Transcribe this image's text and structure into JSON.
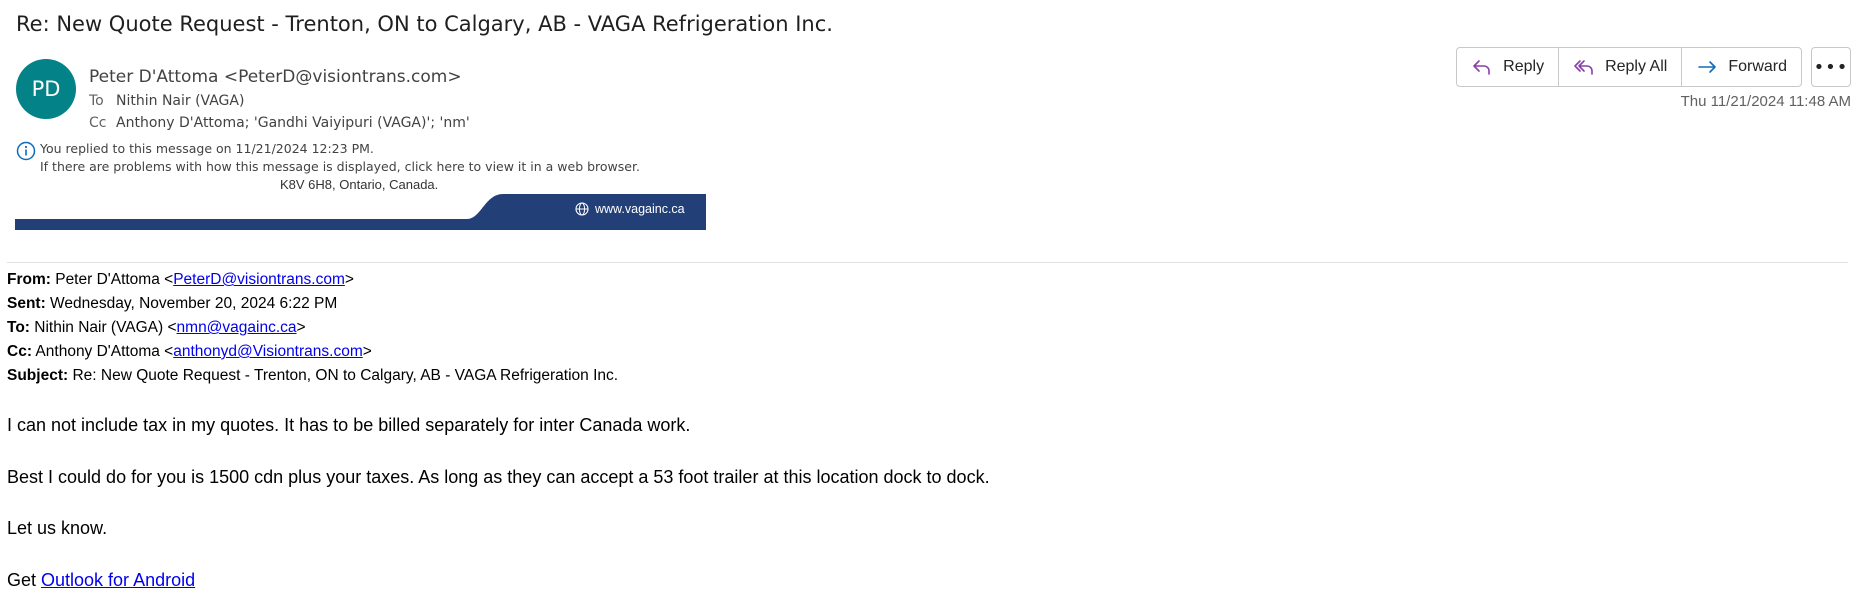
{
  "message": {
    "subject": "Re: New Quote Request - Trenton, ON to Calgary, AB - VAGA Refrigeration Inc.",
    "avatar_initials": "PD",
    "avatar_color": "#038387",
    "sender": "Peter D'Attoma <PeterD@visiontrans.com>",
    "to_label": "To",
    "to_value": "Nithin Nair (VAGA)",
    "cc_label": "Cc",
    "cc_value": "Anthony D'Attoma; 'Gandhi Vaiyipuri (VAGA)'; 'nm'",
    "date": "Thu 11/21/2024 11:48 AM",
    "info_line1": "You replied to this message on 11/21/2024 12:23 PM.",
    "info_line2": "If there are problems with how this message is displayed, click here to view it in a web browser."
  },
  "toolbar": {
    "reply": "Reply",
    "reply_all": "Reply All",
    "forward": "Forward",
    "more": "•••"
  },
  "banner": {
    "address_cut": "K8V 6H8, Ontario, Canada.",
    "website": "www.vagainc.ca",
    "color": "#233f78"
  },
  "quoted_header": {
    "from_label": "From:",
    "from_name": " Peter D'Attoma <",
    "from_email": "PeterD@visiontrans.com",
    "sent_label": "Sent:",
    "sent_value": " Wednesday, November 20, 2024 6:22 PM",
    "to_label": "To:",
    "to_name": " Nithin Nair (VAGA) <",
    "to_email": "nmn@vagainc.ca",
    "cc_label": "Cc:",
    "cc_name": " Anthony D'Attoma <",
    "cc_email": "anthonyd@Visiontrans.com",
    "subject_label": "Subject:",
    "subject_value": " Re: New Quote Request - Trenton, ON to Calgary, AB - VAGA Refrigeration Inc.",
    "close_bracket": ">"
  },
  "body": {
    "p1": "I can not include tax in my quotes. It has to be billed separately for inter Canada work.",
    "p2": "Best I could do for you is 1500 cdn plus your taxes. As long as they can accept a 53 foot trailer at this location dock to dock.",
    "p3": "Let us know.",
    "p4_prefix": "Get ",
    "p4_link": "Outlook for Android"
  }
}
